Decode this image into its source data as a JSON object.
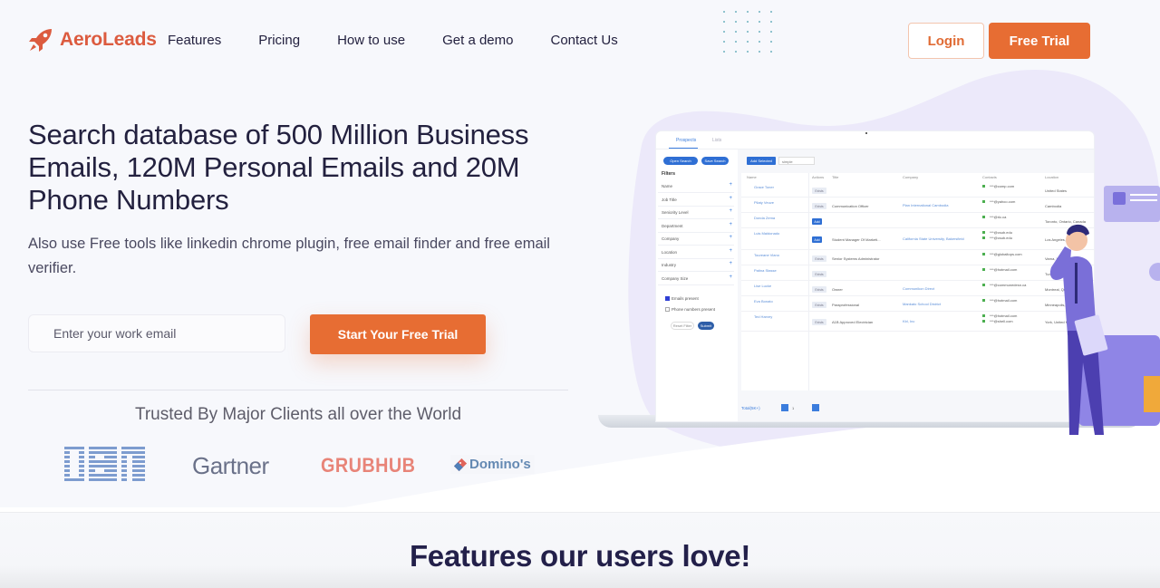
{
  "brand": {
    "name": "AeroLeads",
    "color": "#dc5b3f",
    "icon": "rocket-icon"
  },
  "nav": {
    "items": [
      "Features",
      "Pricing",
      "How to use",
      "Get a demo",
      "Contact Us"
    ],
    "login_label": "Login",
    "trial_label": "Free Trial"
  },
  "hero": {
    "title": "Search database of 500 Million Business Emails, 120M Personal Emails and 20M Phone Numbers",
    "subtitle": "Also use Free tools like linkedin chrome plugin, free email finder and free email verifier.",
    "email_placeholder": "Enter your work email",
    "cta_label": "Start Your Free Trial",
    "accent": "#e76d33"
  },
  "trusted": {
    "heading": "Trusted By Major Clients all over the World",
    "clients": [
      "IBM",
      "Gartner",
      "GRUBHUB",
      "Domino's"
    ]
  },
  "mockup": {
    "tabs": [
      "Prospects",
      "Lists"
    ],
    "open_search": "Open Search",
    "save_search": "Save Search",
    "add_selected": "Add Selected",
    "list_select": "simple",
    "filters_heading": "Filters",
    "filters": [
      "Name",
      "Job Title",
      "Seniority Level",
      "Department",
      "Company",
      "Location",
      "Industry",
      "Company Size"
    ],
    "checks": [
      {
        "label": "Emails present",
        "checked": true
      },
      {
        "label": "Phone numbers present",
        "checked": false
      }
    ],
    "reset_label": "Reset Filter",
    "submit_label": "Submit",
    "columns": [
      "Name",
      "Actions",
      "Title",
      "Company",
      "Contacts",
      "Location"
    ],
    "rows": [
      {
        "name": "Grace Toner",
        "action": "Exists",
        "title": "",
        "company": "",
        "contacts": [
          "***@comp.com"
        ],
        "location": "United States"
      },
      {
        "name": "Pilaty Veuve",
        "action": "Exists",
        "title": "Communication Officer",
        "company": "Plan International Cambodia",
        "contacts": [
          "***@yahoo.com"
        ],
        "location": "Cambodia"
      },
      {
        "name": "Donda Zema",
        "action": "Add",
        "title": "",
        "company": "",
        "contacts": [
          "***@rlc.ca"
        ],
        "location": "Toronto, Ontario, Canada"
      },
      {
        "name": "Luis Maldonado",
        "action": "Add",
        "title": "Student Manager Of Marketi...",
        "company": "California State University, Bakersfield",
        "contacts": [
          "***@csub.edu",
          "***@csub.edu"
        ],
        "location": "Los Angeles, California"
      },
      {
        "name": "Toureane Viano",
        "action": "Exists",
        "title": "Senior Systems Administrator",
        "company": "",
        "contacts": [
          "***@globaltops.com"
        ],
        "location": "Varna, Varna"
      },
      {
        "name": "Patina Stasse",
        "action": "Exists",
        "title": "",
        "company": "",
        "contacts": [
          "***@hotmail.com"
        ],
        "location": "Turkey"
      },
      {
        "name": "Lise Lucke",
        "action": "Exists",
        "title": "Owner",
        "company": "Communikon Direct",
        "contacts": [
          "***@communedesn.ca"
        ],
        "location": "Montreal, Quebec"
      },
      {
        "name": "Eva Bonato",
        "action": "Exists",
        "title": "Paraprofessional",
        "company": "Mankato School District",
        "contacts": [
          "***@hotmail.com"
        ],
        "location": "Minneapolis, Minnesota"
      },
      {
        "name": "Ted Harvey",
        "action": "Exists",
        "title": "A1B Approved Electrician",
        "company": "Kbl, Inc",
        "contacts": [
          "***@hotmail.com",
          "***@shell.com"
        ],
        "location": "York, United Kingdom"
      }
    ],
    "total_label": "Total(5K+)",
    "page": "1"
  },
  "features": {
    "heading": "Features our users love!"
  }
}
